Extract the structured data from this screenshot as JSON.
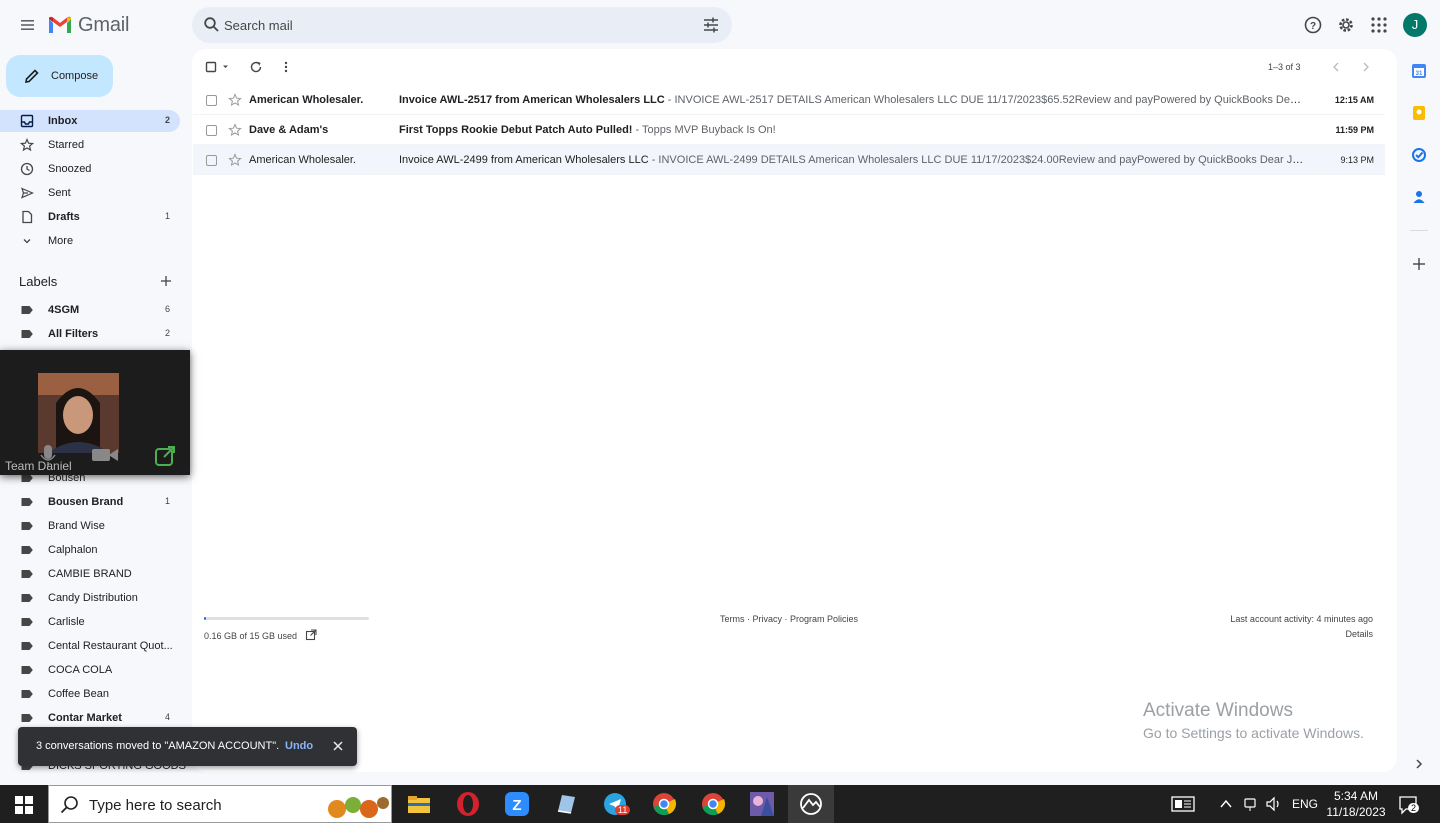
{
  "app": {
    "name": "Gmail",
    "search_placeholder": "Search mail",
    "avatar_initial": "J",
    "compose_label": "Compose"
  },
  "sidebar": {
    "items": [
      {
        "label": "Inbox",
        "count": "2"
      },
      {
        "label": "Starred",
        "count": ""
      },
      {
        "label": "Snoozed",
        "count": ""
      },
      {
        "label": "Sent",
        "count": ""
      },
      {
        "label": "Drafts",
        "count": "1"
      },
      {
        "label": "More",
        "count": ""
      }
    ],
    "labels_heading": "Labels",
    "labels": [
      {
        "label": "4SGM",
        "count": "6"
      },
      {
        "label": "All Filters",
        "count": "2"
      },
      {
        "label": "Bousen",
        "count": ""
      },
      {
        "label": "Bousen Brand",
        "count": "1"
      },
      {
        "label": "Brand Wise",
        "count": ""
      },
      {
        "label": "Calphalon",
        "count": ""
      },
      {
        "label": "CAMBIE BRAND",
        "count": ""
      },
      {
        "label": "Candy Distribution",
        "count": ""
      },
      {
        "label": "Carlisle",
        "count": ""
      },
      {
        "label": "Cental Restaurant Quot...",
        "count": ""
      },
      {
        "label": "COCA COLA",
        "count": ""
      },
      {
        "label": "Coffee Bean",
        "count": ""
      },
      {
        "label": "Contar Market",
        "count": "4"
      },
      {
        "label": "DICKS SPORTING GOODS",
        "count": ""
      }
    ]
  },
  "toolbar": {
    "pager": "1–3 of 3"
  },
  "emails": [
    {
      "sender": "American Wholesaler.",
      "subject": "Invoice AWL-2517 from American Wholesalers LLC",
      "snippet": " - INVOICE AWL-2517 DETAILS American Wholesalers LLC DUE 11/17/2023$65.52Review and payPowered by QuickBooks Dear Jesse Gonzalez",
      "time": "12:15 AM",
      "unread": true
    },
    {
      "sender": "Dave & Adam's",
      "subject": "First Topps Rookie Debut Patch Auto Pulled!",
      "snippet": " - Topps MVP Buyback Is On!",
      "time": "11:59 PM",
      "unread": true
    },
    {
      "sender": "American Wholesaler.",
      "subject": "Invoice AWL-2499 from American Wholesalers LLC",
      "snippet": " - INVOICE AWL-2499 DETAILS American Wholesalers LLC DUE 11/17/2023$24.00Review and payPowered by QuickBooks Dear Jesse Gonzalez",
      "time": "9:13 PM",
      "unread": false
    }
  ],
  "footer": {
    "storage_text": "0.16 GB of 15 GB used",
    "storage_used_fraction": 0.011,
    "links": "Terms · Privacy · Program Policies",
    "activity": "Last account activity: 4 minutes ago",
    "details": "Details"
  },
  "video_call": {
    "participant": "Team Daniel"
  },
  "snackbar": {
    "message": "3 conversations moved to \"AMAZON ACCOUNT\".",
    "undo": "Undo"
  },
  "watermark": {
    "title": "Activate Windows",
    "subtitle": "Go to Settings to activate Windows."
  },
  "taskbar": {
    "search_placeholder": "Type here to search",
    "language": "ENG",
    "time": "5:34 AM",
    "date": "11/18/2023",
    "notification_count": "2",
    "telegram_badge": "11"
  },
  "colors": {
    "accent": "#1a73e8",
    "compose_bg": "#c2e7ff",
    "active_nav": "#d3e3fd",
    "avatar": "#00796b"
  }
}
